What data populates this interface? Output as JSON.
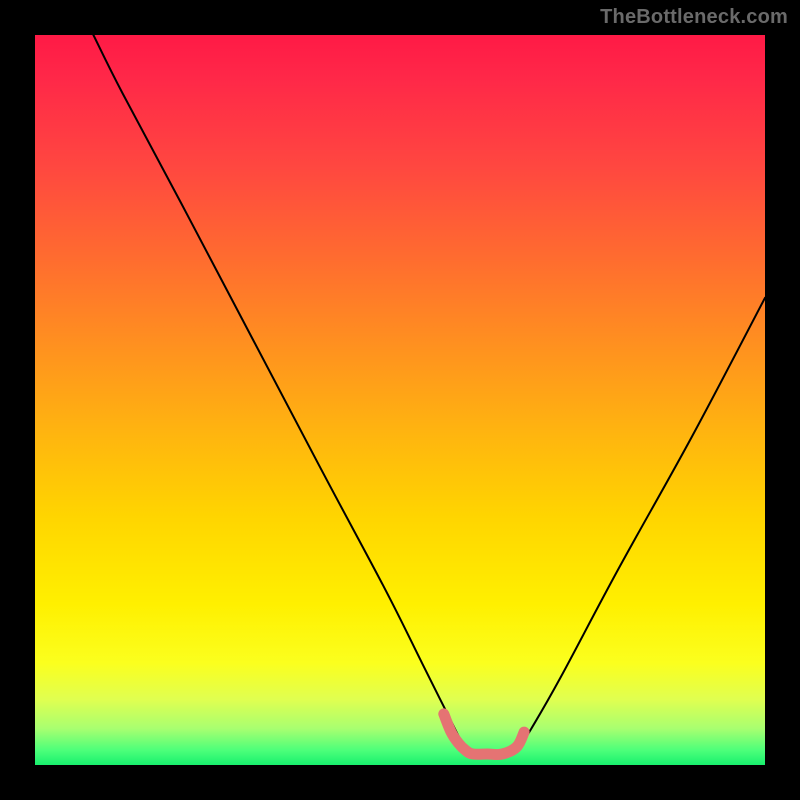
{
  "watermark": {
    "text": "TheBottleneck.com"
  },
  "chart_data": {
    "type": "line",
    "title": "",
    "xlabel": "",
    "ylabel": "",
    "xlim": [
      0,
      100
    ],
    "ylim": [
      0,
      100
    ],
    "series": [
      {
        "name": "main-curve",
        "color": "#000000",
        "x": [
          8,
          12,
          20,
          30,
          40,
          48,
          53,
          56,
          58,
          59,
          60,
          62,
          64,
          66,
          67,
          68,
          72,
          80,
          90,
          100
        ],
        "values": [
          100,
          92,
          77,
          58,
          39,
          24,
          14,
          8,
          4,
          2,
          1.5,
          1.5,
          1.5,
          2,
          3.5,
          5,
          12,
          27,
          45,
          64
        ]
      },
      {
        "name": "pink-floor",
        "color": "#e57373",
        "x": [
          56,
          57,
          58,
          59,
          60,
          62,
          64,
          66,
          67
        ],
        "values": [
          7,
          4.5,
          3,
          2,
          1.5,
          1.5,
          1.5,
          2.5,
          4.5
        ]
      }
    ],
    "grid": false,
    "legend": false
  }
}
